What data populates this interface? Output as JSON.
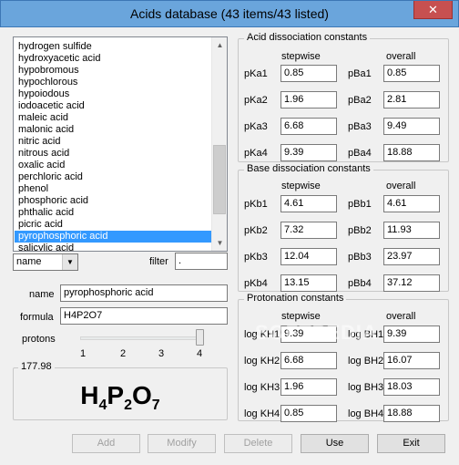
{
  "window": {
    "title": "Acids database (43 items/43 listed)",
    "close_glyph": "✕"
  },
  "list": {
    "items": [
      "hydrogen sulfide",
      "hydroxyacetic acid",
      "hypobromous",
      "hypochlorous",
      "hypoiodous",
      "iodoacetic acid",
      "maleic acid",
      "malonic acid",
      "nitric acid",
      "nitrous acid",
      "oxalic acid",
      "perchloric acid",
      "phenol",
      "phosphoric acid",
      "phthalic acid",
      "picric acid",
      "pyrophosphoric acid"
    ],
    "partial_item": "salicylic acid",
    "selected_index": 16
  },
  "sort": {
    "selected": "name"
  },
  "filter": {
    "label": "filter",
    "value": "."
  },
  "fields": {
    "name_label": "name",
    "name_value": "pyrophosphoric acid",
    "formula_label": "formula",
    "formula_value": "H4P2O7",
    "protons_label": "protons",
    "protons_ticks": [
      "1",
      "2",
      "3",
      "4"
    ],
    "protons_value": 4
  },
  "molar_mass": "177.98",
  "formula_display": [
    {
      "el": "H",
      "n": "4"
    },
    {
      "el": "P",
      "n": "2"
    },
    {
      "el": "O",
      "n": "7"
    }
  ],
  "acid": {
    "title": "Acid dissociation constants",
    "stepwise_head": "stepwise",
    "overall_head": "overall",
    "rows": [
      {
        "k": "pKa1",
        "kv": "0.85",
        "b": "pBa1",
        "bv": "0.85"
      },
      {
        "k": "pKa2",
        "kv": "1.96",
        "b": "pBa2",
        "bv": "2.81"
      },
      {
        "k": "pKa3",
        "kv": "6.68",
        "b": "pBa3",
        "bv": "9.49"
      },
      {
        "k": "pKa4",
        "kv": "9.39",
        "b": "pBa4",
        "bv": "18.88"
      }
    ]
  },
  "base": {
    "title": "Base dissociation constants",
    "stepwise_head": "stepwise",
    "overall_head": "overall",
    "rows": [
      {
        "k": "pKb1",
        "kv": "4.61",
        "b": "pBb1",
        "bv": "4.61"
      },
      {
        "k": "pKb2",
        "kv": "7.32",
        "b": "pBb2",
        "bv": "11.93"
      },
      {
        "k": "pKb3",
        "kv": "12.04",
        "b": "pBb3",
        "bv": "23.97"
      },
      {
        "k": "pKb4",
        "kv": "13.15",
        "b": "pBb4",
        "bv": "37.12"
      }
    ]
  },
  "protonation": {
    "title": "Protonation constants",
    "stepwise_head": "stepwise",
    "overall_head": "overall",
    "rows": [
      {
        "k": "log KH1",
        "kv": "9.39",
        "b": "log BH1",
        "bv": "9.39"
      },
      {
        "k": "log KH2",
        "kv": "6.68",
        "b": "log BH2",
        "bv": "16.07"
      },
      {
        "k": "log KH3",
        "kv": "1.96",
        "b": "log BH3",
        "bv": "18.03"
      },
      {
        "k": "log KH4",
        "kv": "0.85",
        "b": "log BH4",
        "bv": "18.88"
      }
    ]
  },
  "buttons": {
    "add": "Add",
    "modify": "Modify",
    "delete": "Delete",
    "use": "Use",
    "exit": "Exit"
  },
  "watermark": "SOFTPEDIA"
}
